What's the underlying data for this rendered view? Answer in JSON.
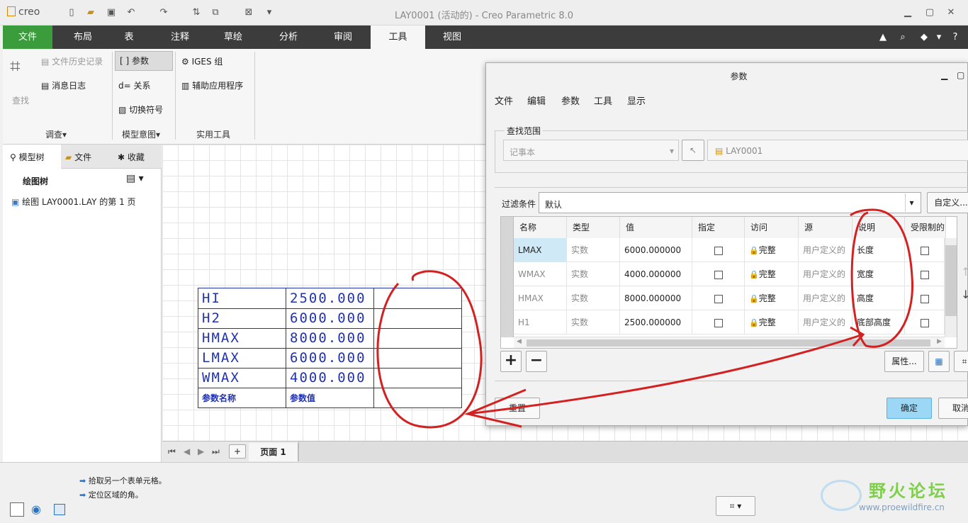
{
  "window": {
    "logo": "creo",
    "title": "LAY0001 (活动的) - Creo Parametric 8.0"
  },
  "ribbon_tabs": [
    "文件",
    "布局",
    "表",
    "注释",
    "草绘",
    "分析",
    "审阅",
    "工具",
    "视图"
  ],
  "ribbon": {
    "find": "查找",
    "file_history": "文件历史记录",
    "message_log": "消息日志",
    "params": "参数",
    "relations": "关系",
    "switch_symbols": "切换符号",
    "iges": "IGES 组",
    "aux_app": "辅助应用程序",
    "groups": [
      "调查",
      "模型意图",
      "实用工具"
    ]
  },
  "sidebar": {
    "tabs": [
      "模型树",
      "文件",
      "收藏"
    ],
    "header": "绘图树",
    "item": "绘图 LAY0001.LAY 的第 1 页"
  },
  "drawing_table": {
    "rows": [
      [
        "HI",
        "2500.000"
      ],
      [
        "H2",
        "6000.000"
      ],
      [
        "HMAX",
        "8000.000"
      ],
      [
        "LMAX",
        "6000.000"
      ],
      [
        "WMAX",
        "4000.000"
      ],
      [
        "参数名称",
        "参数值"
      ]
    ]
  },
  "page_tab": "页面 1",
  "status": {
    "line1": "拾取另一个表单元格。",
    "line2": "定位区域的角。"
  },
  "watermark": {
    "title": "野火论坛",
    "url": "www.proewildfire.cn"
  },
  "dialog": {
    "title": "参数",
    "menu": [
      "文件",
      "编辑",
      "参数",
      "工具",
      "显示"
    ],
    "lookin_label": "查找范围",
    "lookin_type": "记事本",
    "lookin_obj": "LAY0001",
    "filter_label": "过滤条件",
    "filter_value": "默认",
    "customize": "自定义...",
    "columns": [
      "名称",
      "类型",
      "值",
      "指定",
      "访问",
      "源",
      "说明",
      "受限制的"
    ],
    "rows": [
      {
        "name": "LMAX",
        "type": "实数",
        "value": "6000.000000",
        "access": "完整",
        "source": "用户定义的",
        "desc": "长度"
      },
      {
        "name": "WMAX",
        "type": "实数",
        "value": "4000.000000",
        "access": "完整",
        "source": "用户定义的",
        "desc": "宽度"
      },
      {
        "name": "HMAX",
        "type": "实数",
        "value": "8000.000000",
        "access": "完整",
        "source": "用户定义的",
        "desc": "高度"
      },
      {
        "name": "H1",
        "type": "实数",
        "value": "2500.000000",
        "access": "完整",
        "source": "用户定义的",
        "desc": "底部高度"
      }
    ],
    "properties": "属性...",
    "reset": "重置",
    "ok": "确定",
    "cancel": "取消"
  },
  "colors": {
    "ribbon_dark": "#3c3c3c",
    "file_tab": "#3a9c3a",
    "active_tab": "#f6f6f6",
    "drawing_blue": "#2233aa",
    "annotation_red": "#d42020",
    "ok_button": "#9cd8f5"
  }
}
